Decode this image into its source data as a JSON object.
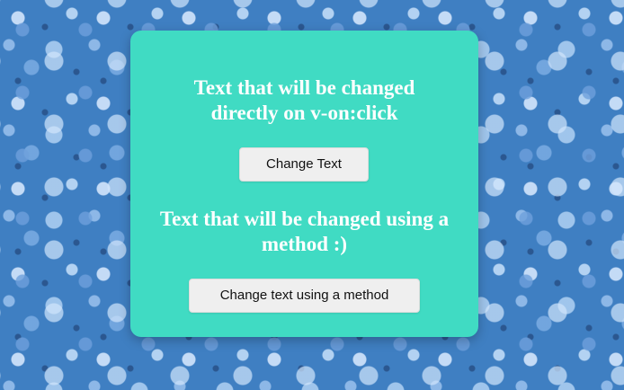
{
  "card": {
    "heading_1": "Text that will be changed directly on v-on:click",
    "button_1_label": "Change Text",
    "heading_2": "Text that will be changed using a method :)",
    "button_2_label": "Change text using a method"
  },
  "colors": {
    "card_background": "#40dbc3",
    "button_background": "#efefef",
    "heading_text": "#ffffff"
  }
}
